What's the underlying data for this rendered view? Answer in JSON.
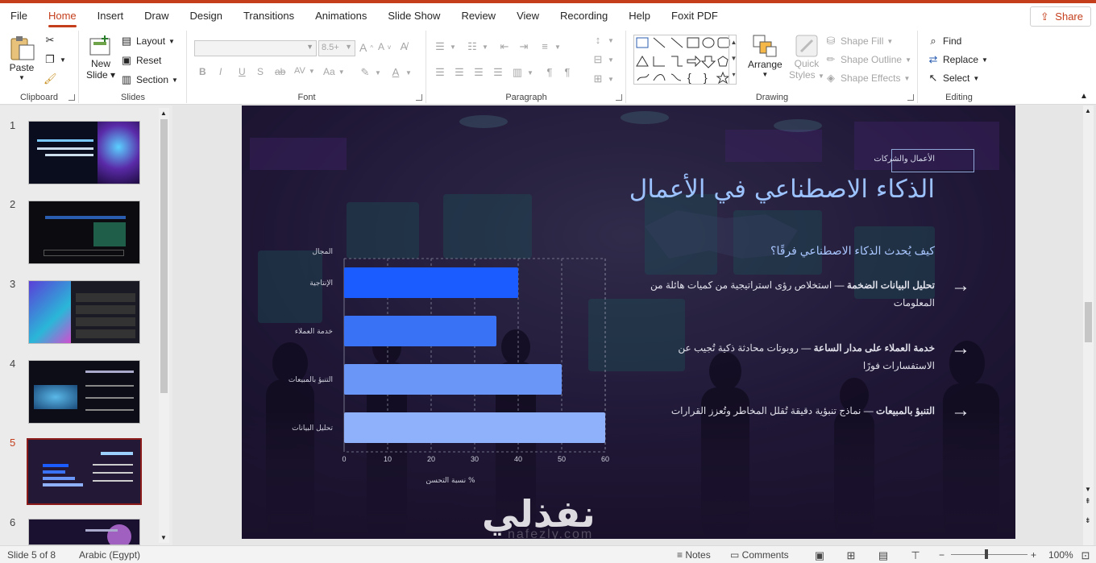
{
  "window": {
    "accent": "#c43e1c"
  },
  "tabs": [
    "File",
    "Home",
    "Insert",
    "Draw",
    "Design",
    "Transitions",
    "Animations",
    "Slide Show",
    "Review",
    "View",
    "Recording",
    "Help",
    "Foxit PDF"
  ],
  "share_label": "Share",
  "ribbon": {
    "clipboard": {
      "label": "Clipboard",
      "paste": "Paste"
    },
    "slides": {
      "label": "Slides",
      "new_slide_1": "New",
      "new_slide_2": "Slide",
      "layout": "Layout",
      "reset": "Reset",
      "section": "Section"
    },
    "font": {
      "label": "Font",
      "size": "8.5+",
      "bold": "B",
      "italic": "I",
      "underline": "U",
      "shadow": "S",
      "strike": "ab",
      "spacing": "AV",
      "case": "Aa"
    },
    "paragraph": {
      "label": "Paragraph"
    },
    "drawing": {
      "label": "Drawing",
      "arrange": "Arrange",
      "quick_styles_1": "Quick",
      "quick_styles_2": "Styles",
      "shape_fill": "Shape Fill",
      "shape_outline": "Shape Outline",
      "shape_effects": "Shape Effects"
    },
    "editing": {
      "label": "Editing",
      "find": "Find",
      "replace": "Replace",
      "select": "Select"
    }
  },
  "thumbnails": [
    {
      "num": "1"
    },
    {
      "num": "2"
    },
    {
      "num": "3"
    },
    {
      "num": "4"
    },
    {
      "num": "5"
    },
    {
      "num": "6"
    }
  ],
  "slide": {
    "tag": "الأعمال والشركات",
    "title": "الذكاء الاصطناعي في الأعمال",
    "subtitle": "كيف يُحدث الذكاء الاصطناعي فرقًا؟",
    "bullets": [
      {
        "bold": "تحليل البيانات الضخمة",
        "text": " — استخلاص رؤى استراتيجية من كميات هائلة من المعلومات"
      },
      {
        "bold": "خدمة العملاء على مدار الساعة",
        "text": " — روبوتات محادثة ذكية تُجيب عن الاستفسارات فورًا"
      },
      {
        "bold": "التنبؤ بالمبيعات",
        "text": " — نماذج تنبؤية دقيقة تُقلل المخاطر وتُعزز القرارات"
      }
    ],
    "watermark": "نفذلي",
    "watermark_sub": "nafezly.com"
  },
  "chart_data": {
    "type": "bar",
    "orientation": "horizontal",
    "category_header": "المجال",
    "categories": [
      "الإنتاجية",
      "خدمة العملاء",
      "التنبؤ بالمبيعات",
      "تحليل البيانات"
    ],
    "values": [
      40,
      35,
      50,
      60
    ],
    "colors": [
      "#1a5cff",
      "#3a72f5",
      "#6a97f7",
      "#8fb0fa"
    ],
    "xlabel": "% نسبة التحسن",
    "xlim": [
      0,
      60
    ],
    "xticks": [
      "0",
      "10",
      "20",
      "30",
      "40",
      "50",
      "60"
    ],
    "grid": true
  },
  "status": {
    "slide": "Slide 5 of 8",
    "language": "Arabic (Egypt)",
    "notes": "Notes",
    "comments": "Comments",
    "zoom": "100%"
  }
}
